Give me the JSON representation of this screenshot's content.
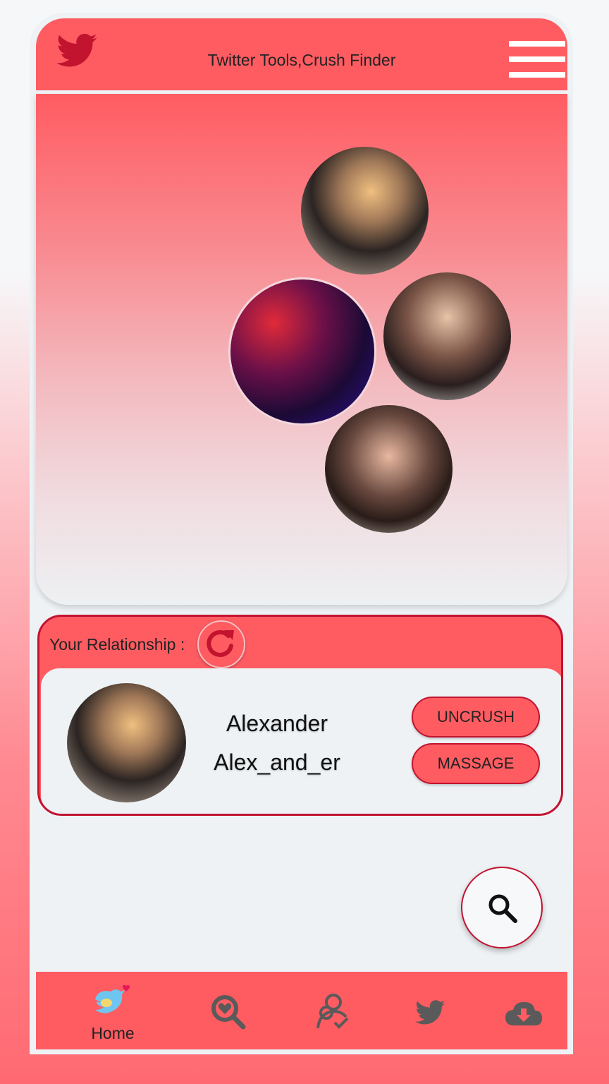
{
  "header": {
    "title": "Twitter Tools,Crush Finder",
    "logo_icon": "twitter-bird-icon",
    "menu_icon": "hamburger-menu-icon"
  },
  "hero": {
    "avatars": [
      "crush-avatar-1",
      "crush-avatar-2",
      "crush-avatar-3",
      "crush-avatar-4"
    ]
  },
  "relationship": {
    "label": "Your Relationship :",
    "refresh_icon": "refresh-icon",
    "name": "Alexander",
    "handle": "Alex_and_er",
    "uncrush_label": "UNCRUSH",
    "massage_label": "MASSAGE"
  },
  "fab": {
    "icon": "search-icon"
  },
  "nav": {
    "items": [
      {
        "label": "Home",
        "icon": "bird-heart-icon"
      },
      {
        "label": "",
        "icon": "search-heart-icon"
      },
      {
        "label": "",
        "icon": "user-check-icon"
      },
      {
        "label": "",
        "icon": "twitter-bird-icon"
      },
      {
        "label": "",
        "icon": "cloud-download-icon"
      }
    ]
  },
  "colors": {
    "accent": "#ff5c62",
    "accent_dark": "#c2132f",
    "surface": "#eef2f5",
    "nav_icon": "#5a5a5a"
  }
}
